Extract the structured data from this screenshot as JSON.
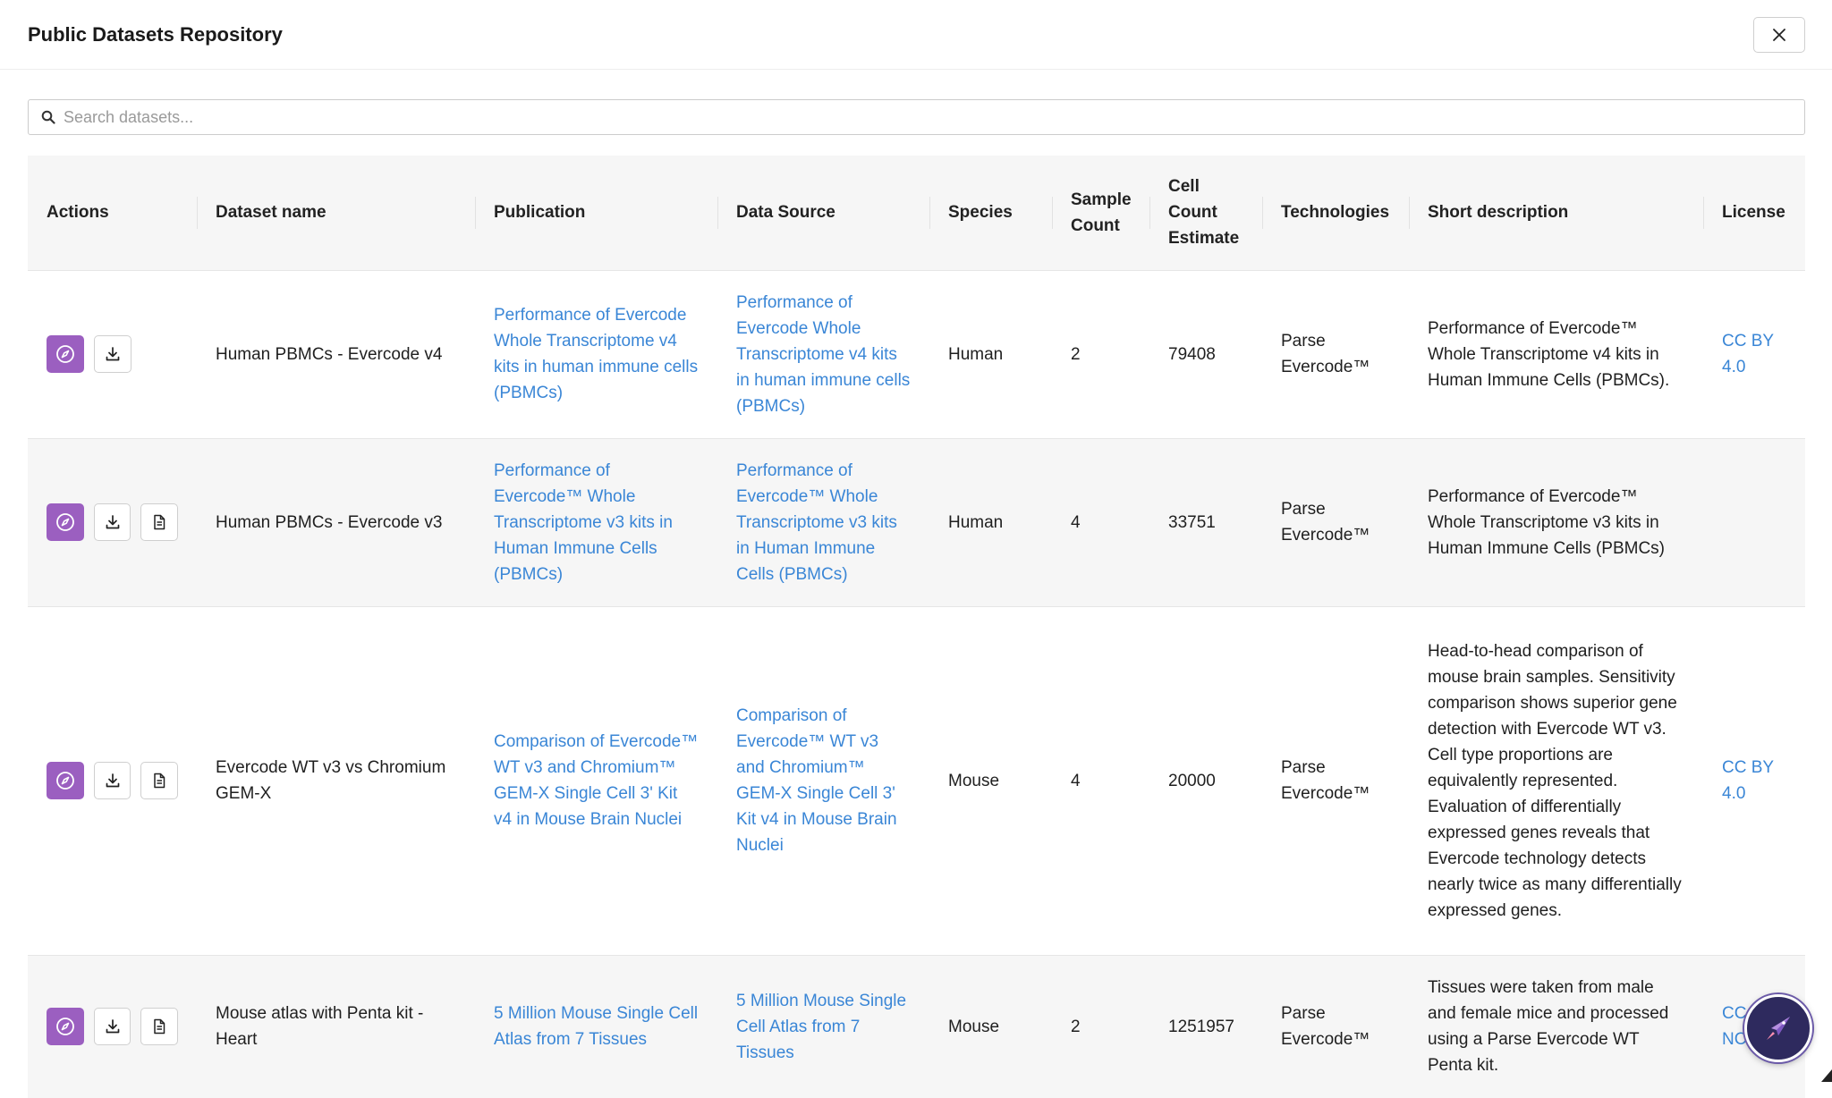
{
  "modal": {
    "title": "Public Datasets Repository"
  },
  "search": {
    "placeholder": "Search datasets..."
  },
  "table": {
    "headers": {
      "actions": "Actions",
      "dataset_name": "Dataset name",
      "publication": "Publication",
      "data_source": "Data Source",
      "species": "Species",
      "sample_count": "Sample Count",
      "cell_count": "Cell Count Estimate",
      "technologies": "Technologies",
      "short_description": "Short description",
      "license": "License"
    },
    "rows": [
      {
        "name": "Human PBMCs - Evercode v4",
        "publication": "Performance of Evercode Whole Transcriptome v4 kits in human immune cells (PBMCs)",
        "data_source": "Performance of Evercode Whole Transcriptome v4 kits in human immune cells (PBMCs)",
        "species": "Human",
        "sample_count": "2",
        "cell_count": "79408",
        "technologies": "Parse Evercode™",
        "description": "Performance of Evercode™ Whole Transcriptome v4 kits in Human Immune Cells (PBMCs).",
        "license": "CC BY 4.0"
      },
      {
        "name": "Human PBMCs - Evercode v3",
        "publication": "Performance of Evercode™ Whole Transcriptome v3 kits in Human Immune Cells (PBMCs)",
        "data_source": "Performance of Evercode™ Whole Transcriptome v3 kits in Human Immune Cells (PBMCs)",
        "species": "Human",
        "sample_count": "4",
        "cell_count": "33751",
        "technologies": "Parse Evercode™",
        "description": "Performance of Evercode™ Whole Transcriptome v3 kits in Human Immune Cells (PBMCs)",
        "license": ""
      },
      {
        "name": "Evercode WT v3 vs Chromium GEM-X",
        "publication": "Comparison of Evercode™ WT v3 and Chromium™ GEM-X Single Cell 3' Kit v4 in Mouse Brain Nuclei",
        "data_source": "Comparison of Evercode™ WT v3 and Chromium™ GEM-X Single Cell 3' Kit v4 in Mouse Brain Nuclei",
        "species": "Mouse",
        "sample_count": "4",
        "cell_count": "20000",
        "technologies": "Parse Evercode™",
        "description": "Head-to-head comparison of mouse brain samples. Sensitivity comparison shows superior gene detection with Evercode WT v3. Cell type proportions are equivalently represented. Evaluation of differentially expressed genes reveals that Evercode technology detects nearly twice as many differentially expressed genes.",
        "license": "CC BY 4.0"
      },
      {
        "name": "Mouse atlas with Penta kit - Heart",
        "publication": "5 Million Mouse Single Cell Atlas from 7 Tissues",
        "data_source": "5 Million Mouse Single Cell Atlas from 7 Tissues",
        "species": "Mouse",
        "sample_count": "2",
        "cell_count": "1251957",
        "technologies": "Parse Evercode™",
        "description": "Tissues were taken from male and female mice and processed using a Parse Evercode WT Penta kit.",
        "license": "CC BY-NC"
      }
    ]
  },
  "icons": {
    "explore": "compass-icon",
    "download": "download-icon",
    "document": "document-icon",
    "close": "close-icon",
    "search": "search-icon",
    "assistant": "rocket-icon"
  },
  "colors": {
    "accent": "#9b5fc0",
    "link": "#3a86d6"
  }
}
